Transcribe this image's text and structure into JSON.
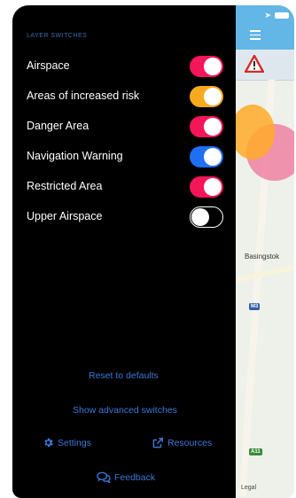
{
  "status_bar": {
    "location_glyph": "➤",
    "battery_icon": "battery-icon"
  },
  "map": {
    "town_label": "Basingstok",
    "road_shield_1": "M3",
    "road_shield_2": "A11",
    "legal_label": "Legal",
    "warning_icon": "warning-triangle-icon",
    "menu_icon": "hamburger-menu-icon"
  },
  "drawer": {
    "section_title": "LAYER SWITCHES",
    "switches": [
      {
        "label": "Airspace",
        "on": true,
        "color": "#f5165a"
      },
      {
        "label": "Areas of increased risk",
        "on": true,
        "color": "#f8aa1e"
      },
      {
        "label": "Danger Area",
        "on": true,
        "color": "#f5165a"
      },
      {
        "label": "Navigation Warning",
        "on": true,
        "color": "#1f6ff3"
      },
      {
        "label": "Restricted Area",
        "on": true,
        "color": "#f5165a"
      },
      {
        "label": "Upper Airspace",
        "on": false,
        "color": "#000000"
      }
    ],
    "reset_label": "Reset to defaults",
    "advanced_label": "Show advanced switches",
    "settings_label": "Settings",
    "resources_label": "Resources",
    "feedback_label": "Feedback"
  },
  "colors": {
    "drawer_bg": "#000000",
    "link": "#3d78d8",
    "map_topbar": "#62b7e6"
  }
}
